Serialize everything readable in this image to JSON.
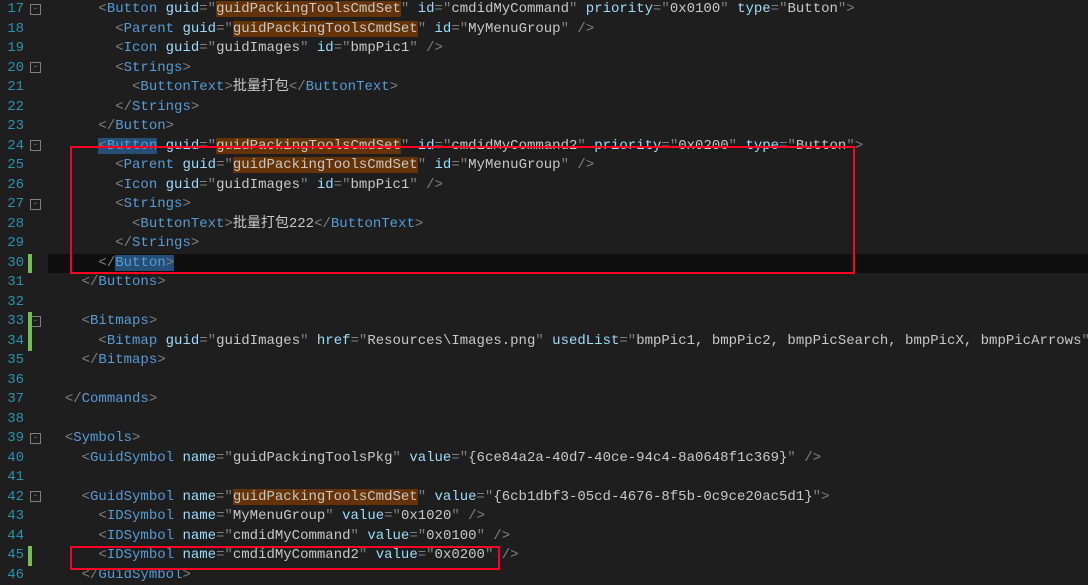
{
  "lineStart": 17,
  "lines": {
    "17": "17",
    "18": "18",
    "19": "19",
    "20": "20",
    "21": "21",
    "22": "22",
    "23": "23",
    "24": "24",
    "25": "25",
    "26": "26",
    "27": "27",
    "28": "28",
    "29": "29",
    "30": "30",
    "31": "31",
    "32": "32",
    "33": "33",
    "34": "34",
    "35": "35",
    "36": "36",
    "37": "37",
    "38": "38",
    "39": "39",
    "40": "40",
    "41": "41",
    "42": "42",
    "43": "43",
    "44": "44",
    "45": "45",
    "46": "46"
  },
  "tok": {
    "Button": "Button",
    "Parent": "Parent",
    "Icon": "Icon",
    "Strings": "Strings",
    "ButtonText": "ButtonText",
    "Buttons": "Buttons",
    "Bitmaps": "Bitmaps",
    "Bitmap": "Bitmap",
    "Commands": "Commands",
    "Symbols": "Symbols",
    "GuidSymbol": "GuidSymbol",
    "IDSymbol": "IDSymbol",
    "guid": "guid",
    "id": "id",
    "priority": "priority",
    "type": "type",
    "href": "href",
    "usedList": "usedList",
    "name": "name",
    "value": "value",
    "guidPackingToolsCmdSet": "guidPackingToolsCmdSet",
    "cmdidMyCommand": "cmdidMyCommand",
    "cmdidMyCommand2": "cmdidMyCommand2",
    "p0x0100": "0x0100",
    "p0x0200": "0x0200",
    "ButtonVal": "Button",
    "MyMenuGroup": "MyMenuGroup",
    "guidImages": "guidImages",
    "bmpPic1": "bmpPic1",
    "btxt1": "批量打包",
    "btxt2": "批量打包222",
    "resImg": "Resources\\Images.png",
    "usedListVal": "bmpPic1, bmpPic2, bmpPicSearch, bmpPicX, bmpPicArrows",
    "guidPackingToolsPkg": "guidPackingToolsPkg",
    "pkgGuid": "{6ce84a2a-40d7-40ce-94c4-8a0648f1c369}",
    "cmdSetGuid": "{6cb1dbf3-05cd-4676-8f5b-0c9ce20ac5d1}",
    "val1020": "0x1020",
    "val0100": "0x0100",
    "val0200": "0x0200"
  },
  "folds": [
    17,
    20,
    24,
    27,
    33,
    39,
    42
  ]
}
